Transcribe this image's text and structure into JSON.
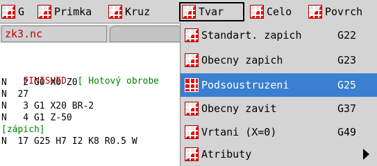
{
  "menubar": {
    "tabs": [
      {
        "label": "G",
        "icon": "grid-red-icon"
      },
      {
        "label": "Primka",
        "icon": "grid-red-icon"
      },
      {
        "label": "Kruz",
        "icon": "grid-red-icon"
      },
      {
        "label": "Tvar",
        "icon": "grid-red-icon",
        "active": true
      },
      {
        "label": "Celo",
        "icon": "grid-red-icon"
      },
      {
        "label": "Povrch",
        "icon": "grid-red-icon"
      }
    ]
  },
  "editor": {
    "file_tab": "zk3.nc",
    "lines": [
      {
        "text": "FINISHED  [ Hotový obrobe",
        "color": "mixed"
      },
      {
        "text": "N   2 G0 X0 Z0",
        "color": "black"
      },
      {
        "text": "N  27",
        "color": "black"
      },
      {
        "text": "N   3 G1 X20 BR-2",
        "color": "black"
      },
      {
        "text": "N   4 G1 Z-50",
        "color": "black"
      },
      {
        "text": "[zápich]",
        "color": "green"
      },
      {
        "text": "N  17 G25 H7 I2 K8 R0.5 W",
        "color": "black"
      }
    ],
    "finished_keyword": "FINISHED",
    "finished_comment": "[ Hotový obrobe"
  },
  "dropdown": {
    "items": [
      {
        "label": "Standart. zapich",
        "shortcut": "G22"
      },
      {
        "label": "Obecny zapich",
        "shortcut": "G23"
      },
      {
        "label": "Podsoustruzeni",
        "shortcut": "G25",
        "selected": true
      },
      {
        "label": "Obecny zavit",
        "shortcut": "G37"
      },
      {
        "label": "Vrtani (X=0)",
        "shortcut": "G49"
      },
      {
        "label": "Atributy",
        "shortcut": "",
        "submenu": true
      }
    ]
  },
  "colors": {
    "accent": "#3a7fd0",
    "menubar": "#d4d4d4",
    "keyword_red": "#c00000",
    "comment_green": "#008000"
  }
}
